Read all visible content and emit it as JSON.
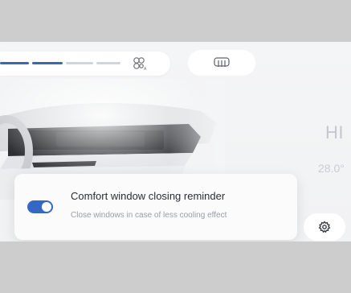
{
  "fan_slider": {
    "level": 0.58,
    "active_color": "#3a68b8",
    "inactive_color": "#cfd5dd",
    "icon": "fan-icon"
  },
  "defrost_button": {
    "icon": "rear-defrost-icon"
  },
  "climate": {
    "mode_label": "HI",
    "temperature": "28.0°"
  },
  "reminder": {
    "title": "Comfort window closing reminder",
    "subtitle": "Close windows in case of less cooling effect",
    "enabled": true,
    "toggle_color": "#3468c2"
  },
  "settings_button": {
    "icon": "gear-icon"
  }
}
